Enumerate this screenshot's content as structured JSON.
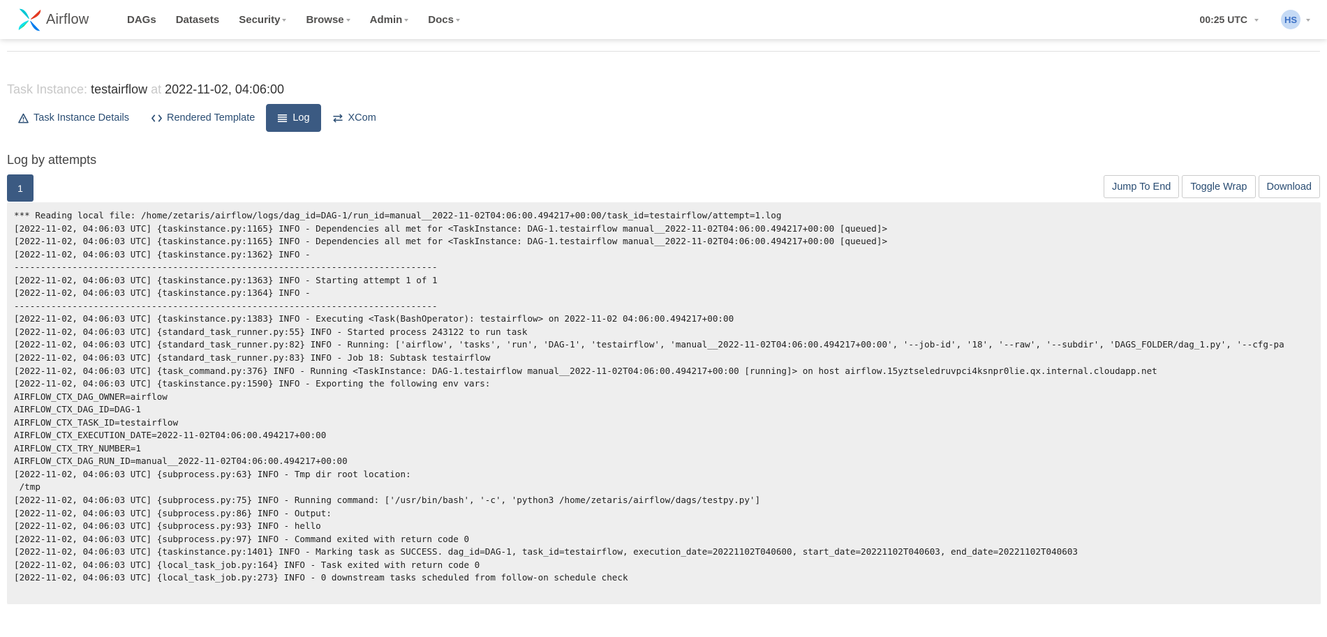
{
  "brand": {
    "name": "Airflow"
  },
  "nav": {
    "items": [
      {
        "label": "DAGs",
        "dropdown": false
      },
      {
        "label": "Datasets",
        "dropdown": false
      },
      {
        "label": "Security",
        "dropdown": true
      },
      {
        "label": "Browse",
        "dropdown": true
      },
      {
        "label": "Admin",
        "dropdown": true
      },
      {
        "label": "Docs",
        "dropdown": true
      }
    ],
    "clock": "00:25 UTC",
    "user_initials": "HS"
  },
  "page": {
    "title_prefix": "Task Instance:",
    "task_id": "testairflow",
    "at_word": "at",
    "execution_date": "2022-11-02, 04:06:00"
  },
  "tabs": [
    {
      "label": "Task Instance Details",
      "icon": "warning-triangle-icon",
      "active": false
    },
    {
      "label": "Rendered Template",
      "icon": "code-icon",
      "active": false
    },
    {
      "label": "Log",
      "icon": "list-icon",
      "active": true
    },
    {
      "label": "XCom",
      "icon": "exchange-arrows-icon",
      "active": false
    }
  ],
  "log_section": {
    "title": "Log by attempts",
    "attempt": "1",
    "buttons": {
      "jump": "Jump To End",
      "wrap": "Toggle Wrap",
      "download": "Download"
    }
  },
  "log_lines": [
    "*** Reading local file: /home/zetaris/airflow/logs/dag_id=DAG-1/run_id=manual__2022-11-02T04:06:00.494217+00:00/task_id=testairflow/attempt=1.log",
    "[2022-11-02, 04:06:03 UTC] {taskinstance.py:1165} INFO - Dependencies all met for <TaskInstance: DAG-1.testairflow manual__2022-11-02T04:06:00.494217+00:00 [queued]>",
    "[2022-11-02, 04:06:03 UTC] {taskinstance.py:1165} INFO - Dependencies all met for <TaskInstance: DAG-1.testairflow manual__2022-11-02T04:06:00.494217+00:00 [queued]>",
    "[2022-11-02, 04:06:03 UTC] {taskinstance.py:1362} INFO - ",
    "--------------------------------------------------------------------------------",
    "[2022-11-02, 04:06:03 UTC] {taskinstance.py:1363} INFO - Starting attempt 1 of 1",
    "[2022-11-02, 04:06:03 UTC] {taskinstance.py:1364} INFO - ",
    "--------------------------------------------------------------------------------",
    "[2022-11-02, 04:06:03 UTC] {taskinstance.py:1383} INFO - Executing <Task(BashOperator): testairflow> on 2022-11-02 04:06:00.494217+00:00",
    "[2022-11-02, 04:06:03 UTC] {standard_task_runner.py:55} INFO - Started process 243122 to run task",
    "[2022-11-02, 04:06:03 UTC] {standard_task_runner.py:82} INFO - Running: ['airflow', 'tasks', 'run', 'DAG-1', 'testairflow', 'manual__2022-11-02T04:06:00.494217+00:00', '--job-id', '18', '--raw', '--subdir', 'DAGS_FOLDER/dag_1.py', '--cfg-pa",
    "[2022-11-02, 04:06:03 UTC] {standard_task_runner.py:83} INFO - Job 18: Subtask testairflow",
    "[2022-11-02, 04:06:03 UTC] {task_command.py:376} INFO - Running <TaskInstance: DAG-1.testairflow manual__2022-11-02T04:06:00.494217+00:00 [running]> on host airflow.15yztseledruvpci4ksnpr0lie.qx.internal.cloudapp.net",
    "[2022-11-02, 04:06:03 UTC] {taskinstance.py:1590} INFO - Exporting the following env vars:",
    "AIRFLOW_CTX_DAG_OWNER=airflow",
    "AIRFLOW_CTX_DAG_ID=DAG-1",
    "AIRFLOW_CTX_TASK_ID=testairflow",
    "AIRFLOW_CTX_EXECUTION_DATE=2022-11-02T04:06:00.494217+00:00",
    "AIRFLOW_CTX_TRY_NUMBER=1",
    "AIRFLOW_CTX_DAG_RUN_ID=manual__2022-11-02T04:06:00.494217+00:00",
    "[2022-11-02, 04:06:03 UTC] {subprocess.py:63} INFO - Tmp dir root location: ",
    " /tmp",
    "[2022-11-02, 04:06:03 UTC] {subprocess.py:75} INFO - Running command: ['/usr/bin/bash', '-c', 'python3 /home/zetaris/airflow/dags/testpy.py']",
    "[2022-11-02, 04:06:03 UTC] {subprocess.py:86} INFO - Output:",
    "[2022-11-02, 04:06:03 UTC] {subprocess.py:93} INFO - hello",
    "[2022-11-02, 04:06:03 UTC] {subprocess.py:97} INFO - Command exited with return code 0",
    "[2022-11-02, 04:06:03 UTC] {taskinstance.py:1401} INFO - Marking task as SUCCESS. dag_id=DAG-1, task_id=testairflow, execution_date=20221102T040600, start_date=20221102T040603, end_date=20221102T040603",
    "[2022-11-02, 04:06:03 UTC] {local_task_job.py:164} INFO - Task exited with return code 0",
    "[2022-11-02, 04:06:03 UTC] {local_task_job.py:273} INFO - 0 downstream tasks scheduled from follow-on schedule check"
  ]
}
